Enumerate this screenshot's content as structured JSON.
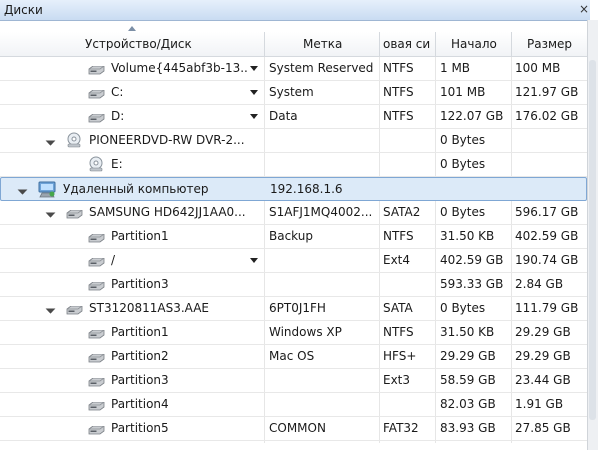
{
  "window": {
    "title": "Диски",
    "close_glyph": "×"
  },
  "columns": [
    {
      "label": "Устройство/Диск"
    },
    {
      "label": "Метка"
    },
    {
      "label": "овая си"
    },
    {
      "label": "Начало"
    },
    {
      "label": "Размер"
    }
  ],
  "rows": [
    {
      "name": "Volume{445abf3b-13..",
      "label": "System Reserved",
      "fs": "NTFS",
      "start": "1 MB",
      "size": "100 MB"
    },
    {
      "name": "C:",
      "label": "System",
      "fs": "NTFS",
      "start": "101 MB",
      "size": "121.97 GB"
    },
    {
      "name": "D:",
      "label": "Data",
      "fs": "NTFS",
      "start": "122.07 GB",
      "size": "176.02 GB"
    },
    {
      "name": "PIONEERDVD-RW DVR-2...",
      "label": "",
      "fs": "",
      "start": "0 Bytes",
      "size": ""
    },
    {
      "name": "E:",
      "label": "",
      "fs": "",
      "start": "0 Bytes",
      "size": ""
    },
    {
      "name": "Удаленный компьютер",
      "label": "192.168.1.6",
      "fs": "",
      "start": "",
      "size": ""
    },
    {
      "name": "SAMSUNG HD642JJ1AA0...",
      "label": "S1AFJ1MQ4002...",
      "fs": "SATA2",
      "start": "0 Bytes",
      "size": "596.17 GB"
    },
    {
      "name": "Partition1",
      "label": "Backup",
      "fs": "NTFS",
      "start": "31.50 KB",
      "size": "402.59 GB"
    },
    {
      "name": "/",
      "label": "",
      "fs": "Ext4",
      "start": "402.59 GB",
      "size": "190.74 GB"
    },
    {
      "name": "Partition3",
      "label": "",
      "fs": "",
      "start": "593.33 GB",
      "size": "2.84 GB"
    },
    {
      "name": "ST3120811AS3.AAE",
      "label": "6PT0J1FH",
      "fs": "SATA",
      "start": "0 Bytes",
      "size": "111.79 GB"
    },
    {
      "name": "Partition1",
      "label": "Windows XP",
      "fs": "NTFS",
      "start": "31.50 KB",
      "size": "29.29 GB"
    },
    {
      "name": "Partition2",
      "label": "Mac OS",
      "fs": "HFS+",
      "start": "29.29 GB",
      "size": "29.29 GB"
    },
    {
      "name": "Partition3",
      "label": "",
      "fs": "Ext3",
      "start": "58.59 GB",
      "size": "23.44 GB"
    },
    {
      "name": "Partition4",
      "label": "",
      "fs": "",
      "start": "82.03 GB",
      "size": "1.91 GB"
    },
    {
      "name": "Partition5",
      "label": "COMMON",
      "fs": "FAT32",
      "start": "83.93 GB",
      "size": "27.85 GB"
    }
  ],
  "icons": {
    "row_icons": [
      "disk-icon",
      "disk-icon",
      "disk-icon",
      "cd-drive-icon",
      "cd-icon",
      "network-computer-icon",
      "disk-icon",
      "disk-icon",
      "disk-icon",
      "disk-icon",
      "disk-icon",
      "disk-icon",
      "disk-icon",
      "disk-icon",
      "disk-icon",
      "disk-icon"
    ]
  },
  "colors": {
    "accent": "#7fa7d4",
    "selected_bg": "#dceaf8",
    "header_border": "#d5d9de"
  }
}
